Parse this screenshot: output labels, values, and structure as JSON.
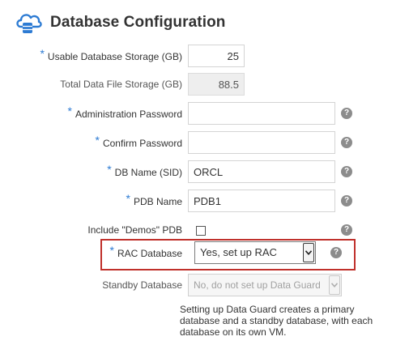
{
  "header": {
    "title": "Database Configuration",
    "icon": "cloud-database-icon"
  },
  "fields": {
    "usable_storage": {
      "label": "Usable Database Storage (GB)",
      "required": "*",
      "value": "25"
    },
    "total_storage": {
      "label": "Total Data File Storage (GB)",
      "value": "88.5"
    },
    "admin_password": {
      "label": "Administration Password",
      "required": "*",
      "value": ""
    },
    "confirm_password": {
      "label": "Confirm Password",
      "required": "*",
      "value": ""
    },
    "db_name": {
      "label": "DB Name (SID)",
      "required": "*",
      "value": "ORCL"
    },
    "pdb_name": {
      "label": "PDB Name",
      "required": "*",
      "value": "PDB1"
    },
    "include_demos": {
      "label": "Include \"Demos\" PDB",
      "checked": false
    },
    "rac_database": {
      "label": "RAC Database",
      "required": "*",
      "selected": "Yes, set up RAC"
    },
    "standby_database": {
      "label": "Standby Database",
      "selected": "No, do not set up Data Guard",
      "disabled": true
    }
  },
  "help_glyph": "?",
  "note": "Setting up Data Guard creates a primary database and a standby database, with each database on its own VM.",
  "colors": {
    "required": "#2d7bd3",
    "highlight_border": "#c0302b",
    "help_icon": "#8c8c8c"
  }
}
